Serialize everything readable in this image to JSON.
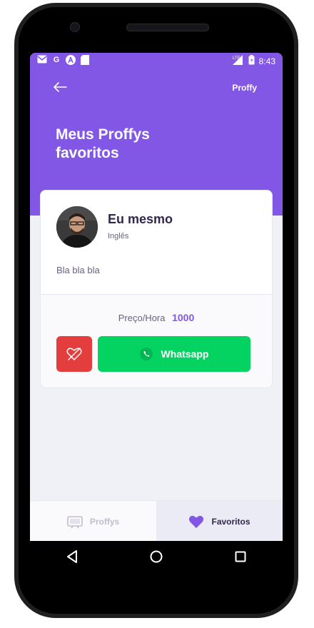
{
  "status_bar": {
    "time": "8:43"
  },
  "header": {
    "brand": "Proffy",
    "title_line1": "Meus Proffys",
    "title_line2": "favoritos"
  },
  "teacher": {
    "name": "Eu mesmo",
    "subject": "Inglês",
    "bio": "Bla bla bla",
    "price_label": "Preço/Hora",
    "price_value": "1000"
  },
  "actions": {
    "whatsapp_label": "Whatsapp"
  },
  "tabs": [
    {
      "label": "Proffys"
    },
    {
      "label": "Favoritos"
    }
  ],
  "colors": {
    "primary": "#8257e5",
    "favorite_red": "#e33d3d",
    "whatsapp_green": "#04d361"
  },
  "icons": [
    "back-arrow-icon",
    "heart-outline-icon",
    "whatsapp-icon",
    "tv-icon",
    "heart-icon",
    "back-nav-icon",
    "home-nav-icon",
    "recents-nav-icon"
  ]
}
